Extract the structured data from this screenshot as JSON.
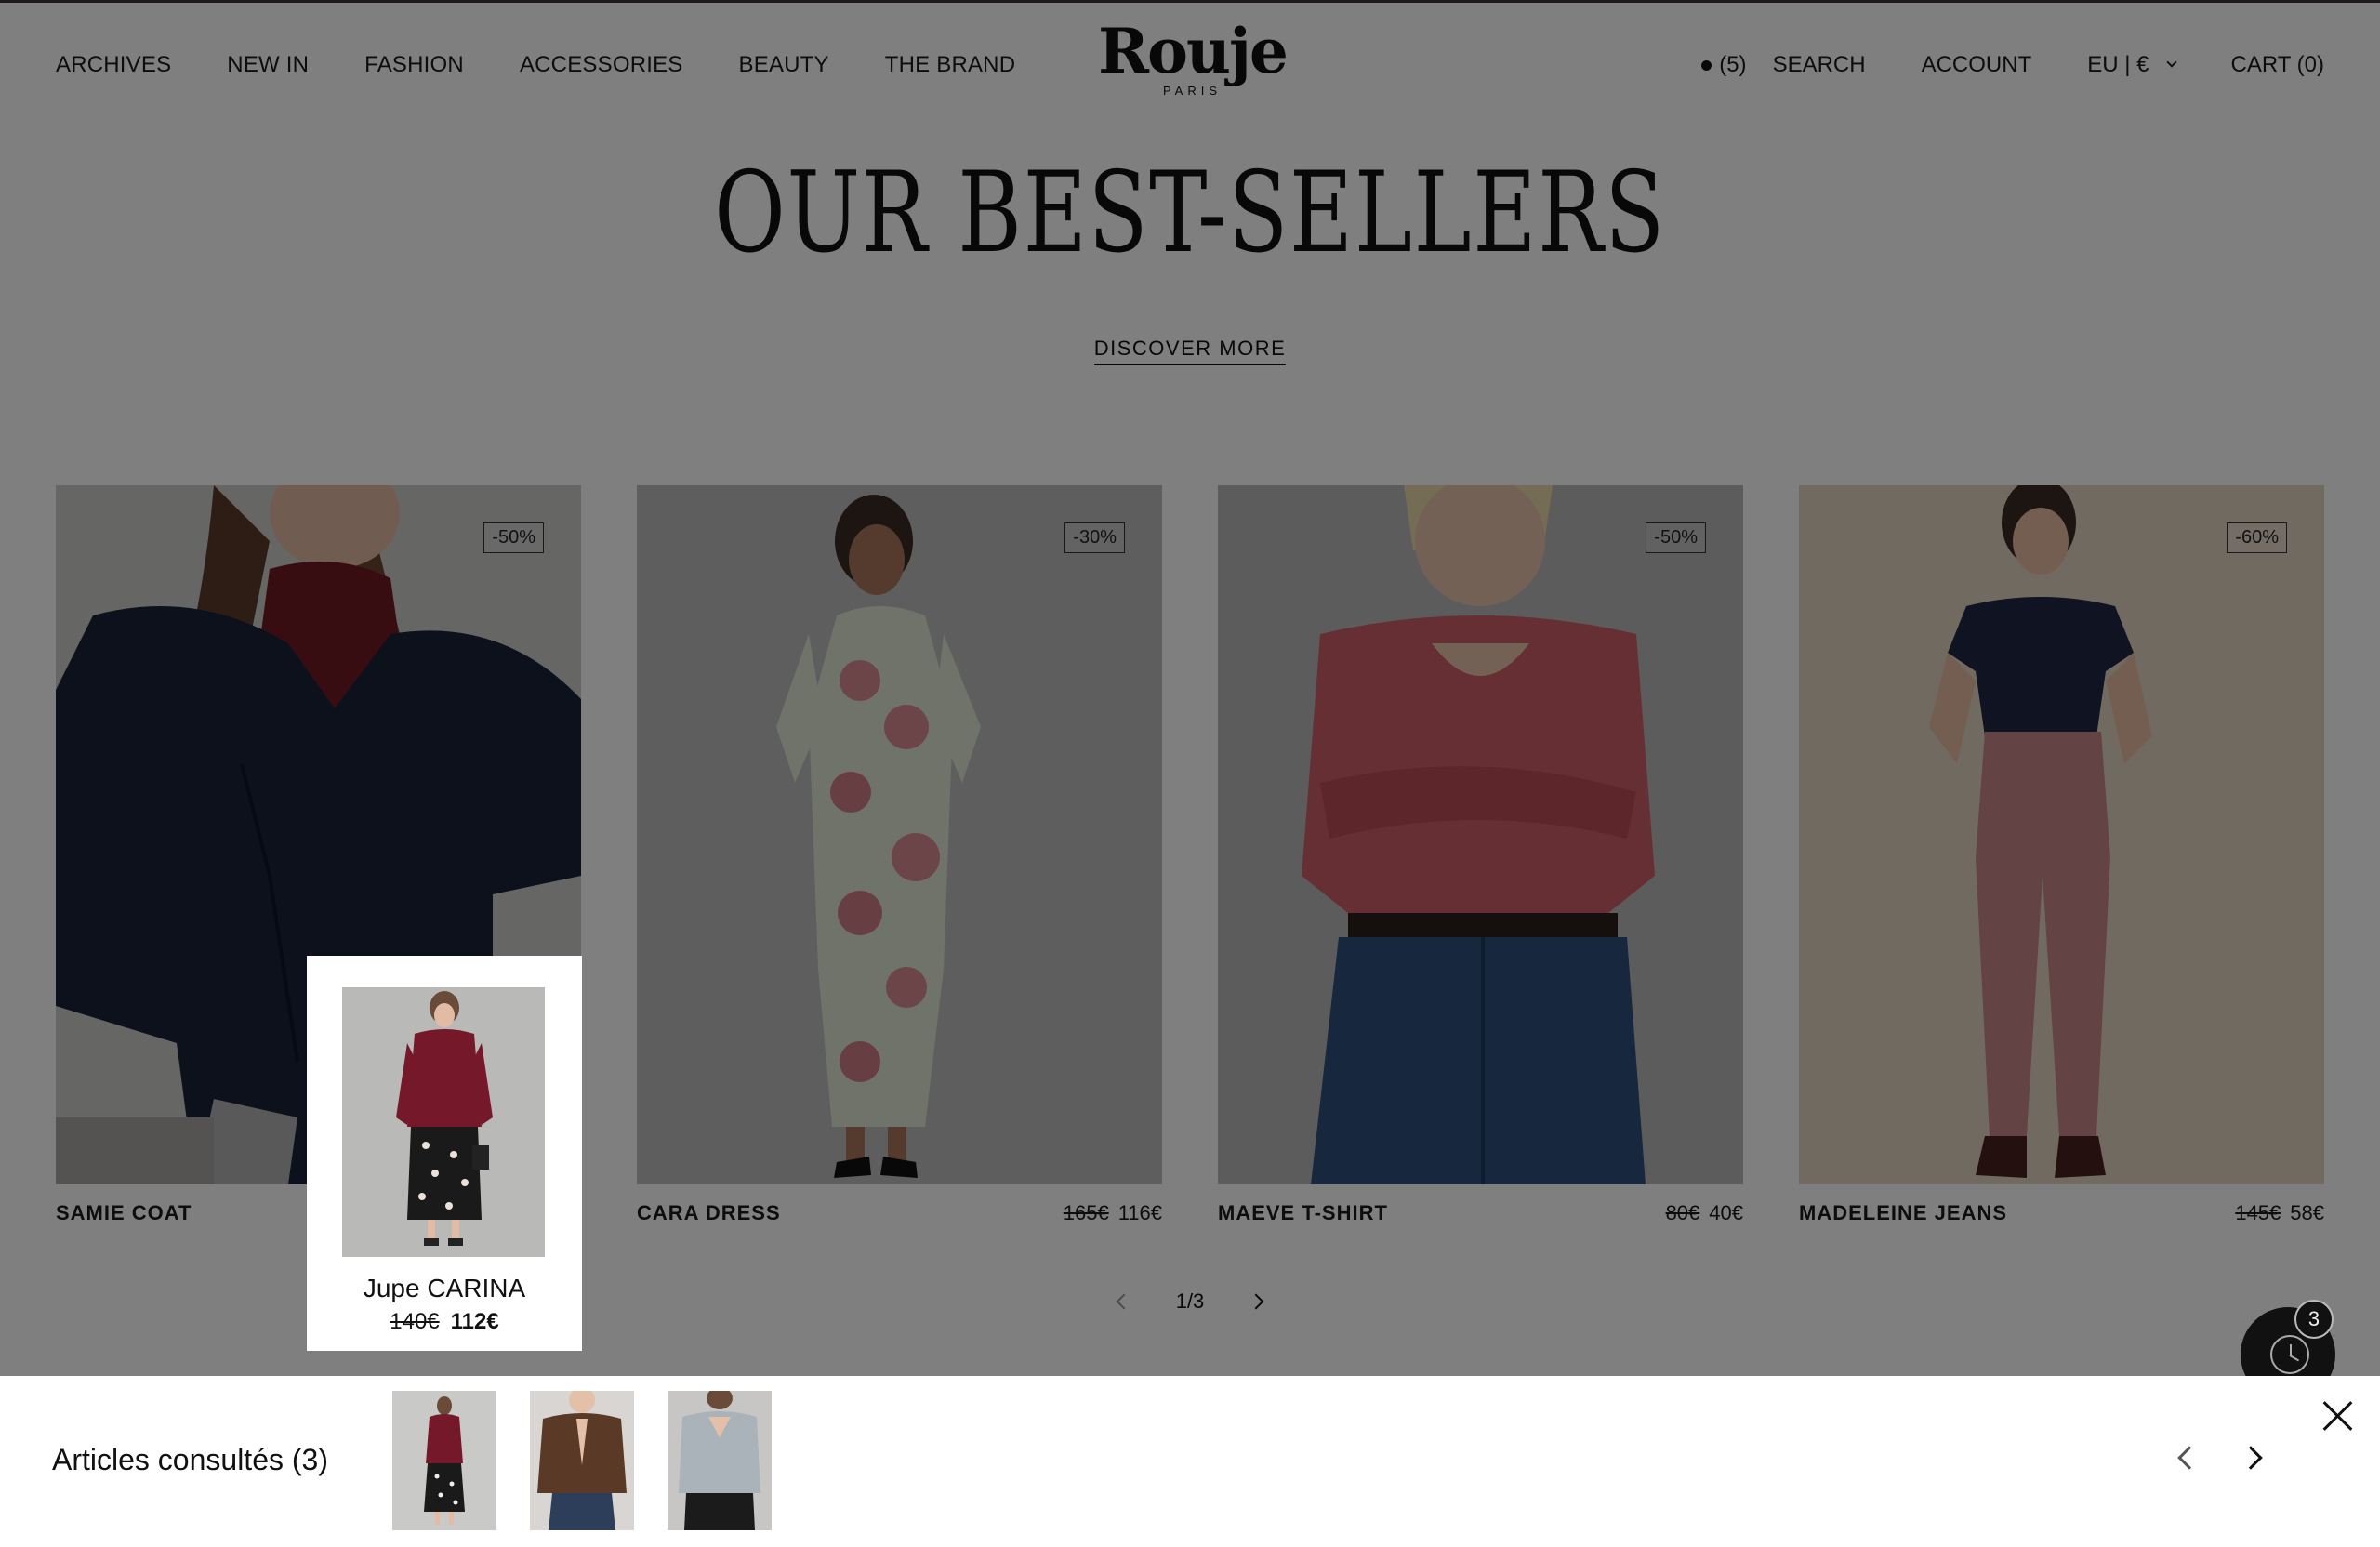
{
  "header": {
    "nav_left": [
      "ARCHIVES",
      "NEW IN",
      "FASHION",
      "ACCESSORIES",
      "BEAUTY",
      "THE BRAND"
    ],
    "logo": {
      "word": "Rouje",
      "sub": "PARIS"
    },
    "wishlist_count": "(5)",
    "search": "SEARCH",
    "account": "ACCOUNT",
    "currency": "EU | €",
    "cart": "CART (0)"
  },
  "hero": {
    "title": "OUR BEST-SELLERS",
    "discover": "DISCOVER MORE"
  },
  "products": [
    {
      "name": "SAMIE COAT",
      "badge": "-50%",
      "old_price": "",
      "price": ""
    },
    {
      "name": "CARA DRESS",
      "badge": "-30%",
      "old_price": "165€",
      "price": "116€"
    },
    {
      "name": "MAEVE T-SHIRT",
      "badge": "-50%",
      "old_price": "80€",
      "price": "40€"
    },
    {
      "name": "MADELEINE JEANS",
      "badge": "-60%",
      "old_price": "145€",
      "price": "58€"
    }
  ],
  "pager": {
    "label": "1/3"
  },
  "popup": {
    "name": "Jupe CARINA",
    "old_price": "140€",
    "price": "112€"
  },
  "history": {
    "count": "3"
  },
  "drawer": {
    "title": "Articles consultés (3)"
  },
  "colors": {
    "overlay": "#000000",
    "accent": "#111111"
  },
  "icons": [
    "dot-icon",
    "chevron-down-icon",
    "chevron-left-icon",
    "chevron-right-icon",
    "clock-icon",
    "close-icon"
  ]
}
